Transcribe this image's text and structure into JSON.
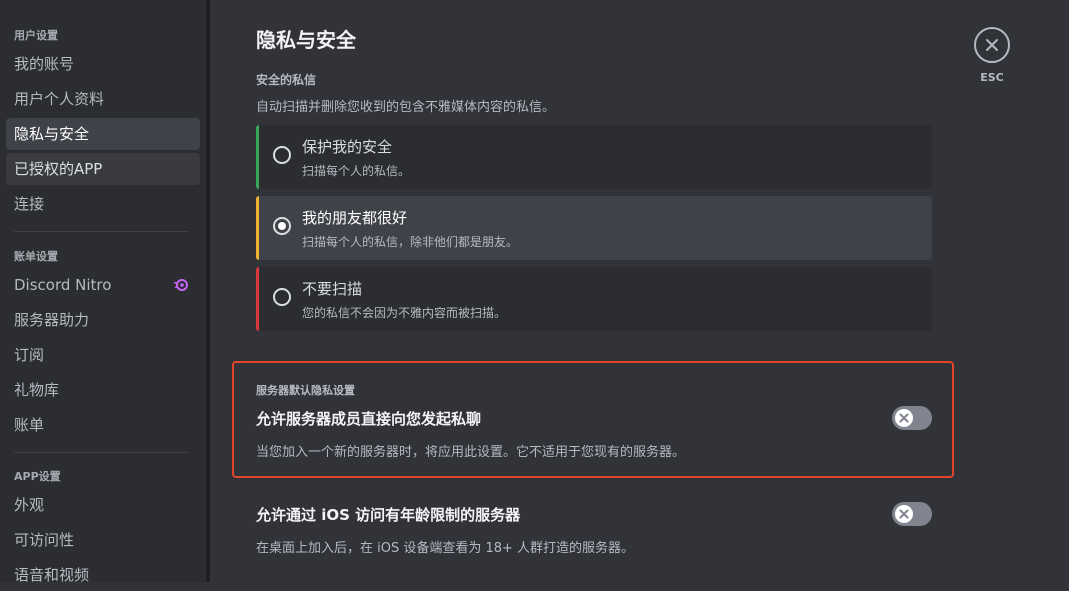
{
  "sidebar": {
    "user_settings_header": "用户设置",
    "user_items": [
      {
        "label": "我的账号"
      },
      {
        "label": "用户个人资料"
      },
      {
        "label": "隐私与安全"
      },
      {
        "label": "已授权的APP"
      },
      {
        "label": "连接"
      }
    ],
    "billing_header": "账单设置",
    "billing_items": [
      {
        "label": "Discord Nitro",
        "icon": "nitro-icon"
      },
      {
        "label": "服务器助力"
      },
      {
        "label": "订阅"
      },
      {
        "label": "礼物库"
      },
      {
        "label": "账单"
      }
    ],
    "app_header": "APP设置",
    "app_items": [
      {
        "label": "外观"
      },
      {
        "label": "可访问性"
      },
      {
        "label": "语音和视频"
      }
    ]
  },
  "main": {
    "title": "隐私与安全",
    "safe_dm": {
      "label": "安全的私信",
      "description": "自动扫描并删除您收到的包含不雅媒体内容的私信。",
      "options": [
        {
          "title": "保护我的安全",
          "subtitle": "扫描每个人的私信。",
          "color": "#3ba55d",
          "selected": false
        },
        {
          "title": "我的朋友都很好",
          "subtitle": "扫描每个人的私信，除非他们都是朋友。",
          "color": "#f0b232",
          "selected": true
        },
        {
          "title": "不要扫描",
          "subtitle": "您的私信不会因为不雅内容而被扫描。",
          "color": "#da373c",
          "selected": false
        }
      ]
    },
    "server_privacy": {
      "label": "服务器默认隐私设置",
      "title": "允许服务器成员直接向您发起私聊",
      "description": "当您加入一个新的服务器时，将应用此设置。它不适用于您现有的服务器。",
      "enabled": false
    },
    "ios_age": {
      "title": "允许通过 iOS 访问有年龄限制的服务器",
      "description": "在桌面上加入后，在 iOS 设备端查看为 18+ 人群打造的服务器。",
      "enabled": false
    }
  },
  "close": {
    "label": "ESC",
    "icon": "close-icon"
  },
  "colors": {
    "highlight_border": "#e3442c",
    "nitro": "#c565f6"
  }
}
